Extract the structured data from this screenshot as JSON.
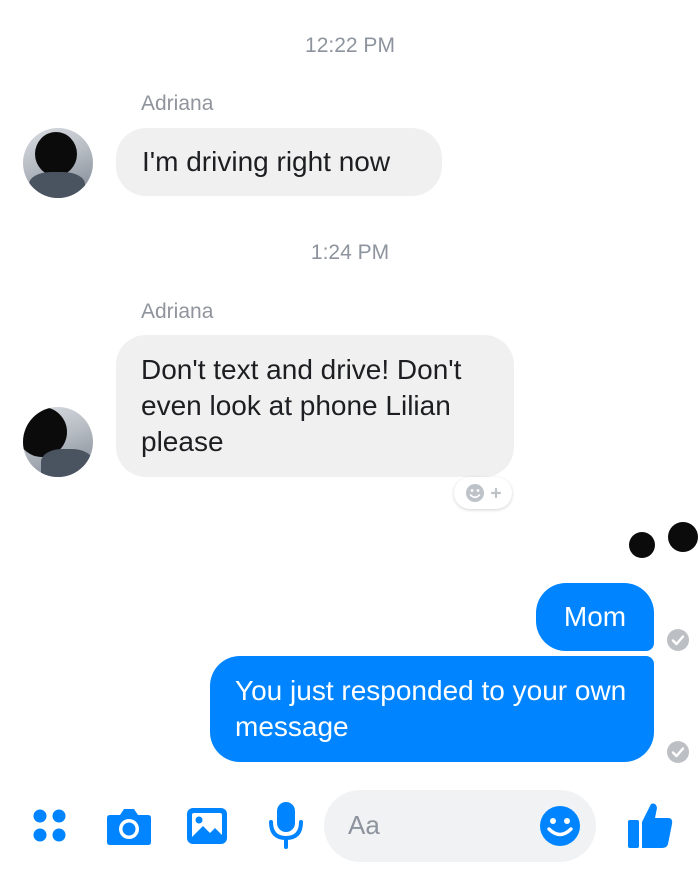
{
  "conversation": {
    "groups": [
      {
        "timestamp": "12:22 PM",
        "sender": "Adriana",
        "messages": [
          "I'm driving right now"
        ]
      },
      {
        "timestamp": "1:24 PM",
        "sender": "Adriana",
        "messages": [
          "Don't text and drive! Don't even look at phone Lilian please"
        ]
      }
    ],
    "outgoing": [
      "Mom",
      "You just responded to your own message"
    ]
  },
  "composer": {
    "placeholder": "Aa"
  },
  "icons": {
    "apps": "four-dots-icon",
    "camera": "camera-icon",
    "gallery": "image-icon",
    "voice": "microphone-icon",
    "emoji": "smiley-icon",
    "like": "thumbs-up-icon",
    "react": "add-reaction-icon",
    "sent": "check-circle-icon"
  },
  "colors": {
    "accent": "#0084ff",
    "incoming_bubble": "#f1f0f0",
    "timestamp": "#8d949e"
  }
}
